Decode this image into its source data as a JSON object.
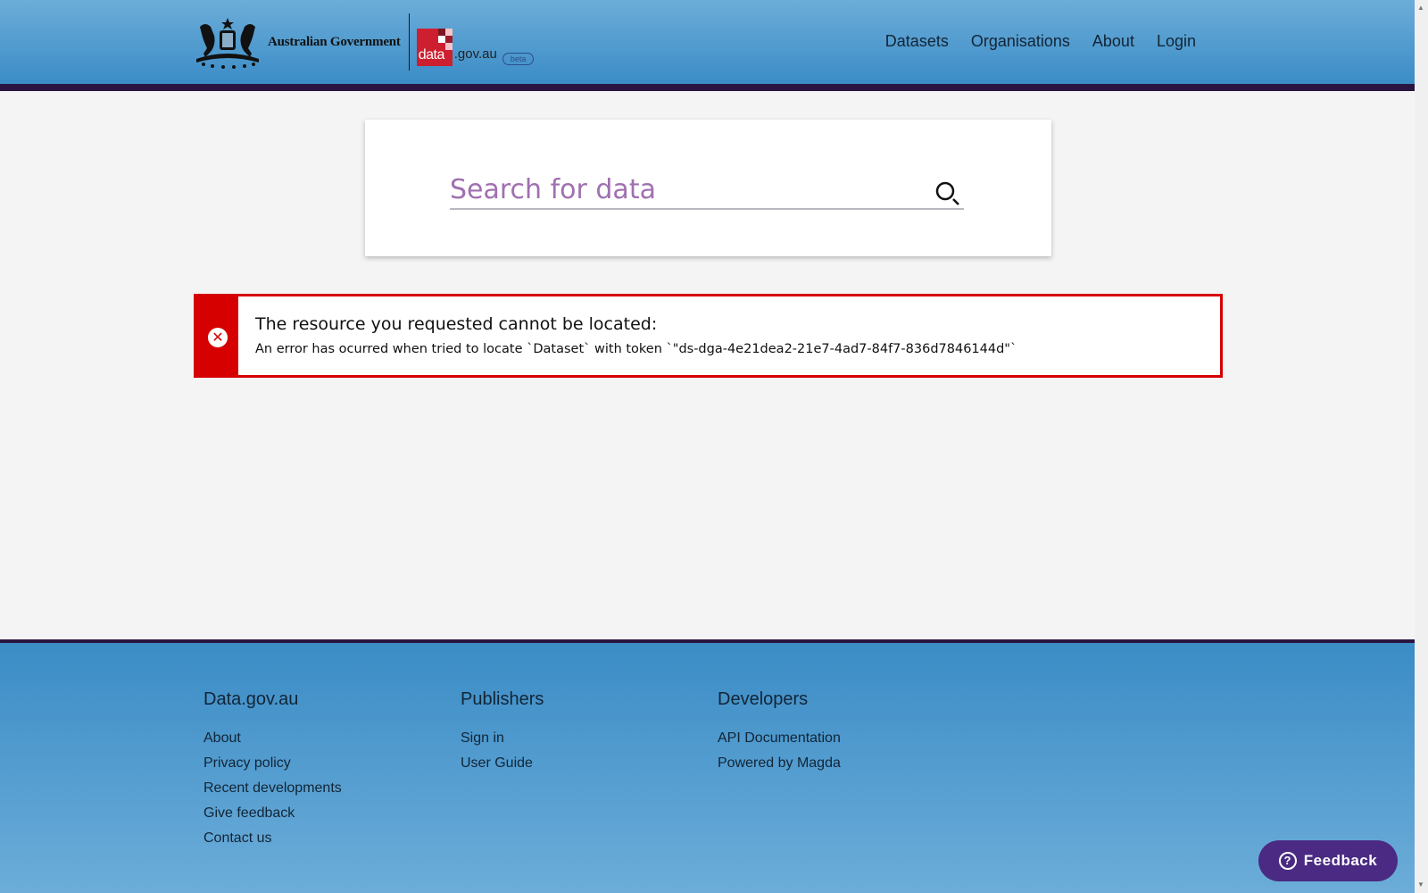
{
  "header": {
    "gov_name": "Australian Government",
    "logo_data": "data",
    "logo_domain": ".gov.au",
    "badge": "beta",
    "nav": [
      "Datasets",
      "Organisations",
      "About",
      "Login"
    ]
  },
  "search": {
    "placeholder": "Search for data",
    "icon": "search-icon"
  },
  "error": {
    "title": "The resource you requested cannot be located:",
    "message": "An error has ocurred when tried to locate `Dataset` with token `\"ds-dga-4e21dea2-21e7-4ad7-84f7-836d7846144d\"`",
    "icon": "close-icon"
  },
  "footer": {
    "columns": [
      {
        "heading": "Data.gov.au",
        "links": [
          "About",
          "Privacy policy",
          "Recent developments",
          "Give feedback",
          "Contact us"
        ]
      },
      {
        "heading": "Publishers",
        "links": [
          "Sign in",
          "User Guide"
        ]
      },
      {
        "heading": "Developers",
        "links": [
          "API Documentation",
          "Powered by Magda"
        ]
      }
    ]
  },
  "feedback": {
    "label": "Feedback",
    "icon": "question-icon"
  },
  "colors": {
    "accent": "#3b8cc6",
    "error": "#d60000",
    "dark_bar": "#2a1540",
    "feedback": "#4a2a82"
  }
}
